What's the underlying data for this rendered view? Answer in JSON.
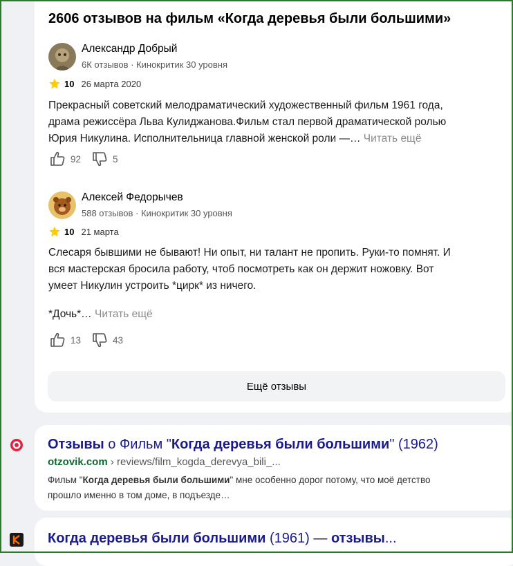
{
  "reviews_block": {
    "title": "2606 отзывов на фильм «Когда деревья были большими»",
    "reviews": [
      {
        "author": "Александр Добрый",
        "meta": "6К отзывов · Кинокритик 30 уровня",
        "score": "10",
        "date": "26 марта 2020",
        "text_lines": [
          "Прекрасный советский мелодраматический художественный фильм 1961 года,",
          "драма режиссёра Льва Кулиджанова.Фильм стал первой драматической ролью",
          "Юрия Никулина. Исполнительница главной женской роли —…"
        ],
        "read_more": "Читать ещё",
        "likes": "92",
        "dislikes": "5"
      },
      {
        "author": "Алексей Федорычев",
        "meta": "588 отзывов · Кинокритик 30 уровня",
        "score": "10",
        "date": "21 марта",
        "text_lines": [
          "Слесаря бывшими не бывают! Ни опыт, ни талант не пропить. Руки-то помнят. И",
          "вся мастерская бросила работу, чтоб посмотреть как он держит ножовку. Вот",
          "умеет Никулин устроить *цирк* из ничего."
        ],
        "tail": "*Дочь*…",
        "read_more": "Читать ещё",
        "likes": "13",
        "dislikes": "43"
      }
    ],
    "more_button": "Ещё отзывы"
  },
  "results": [
    {
      "favicon": "otzovik-icon",
      "title_bold": "Отзывы",
      "title_mid": " о Фильм \"",
      "title_bold2": "Когда деревья были большими",
      "title_end": "\" (1962)",
      "host": "otzovik.com",
      "path": " › reviews/film_kogda_derevya_bili_...",
      "snippet_pre": "Фильм \"",
      "snippet_bold": "Когда деревья были большими",
      "snippet_post": "\" мне особенно дорог потому, что моё детство",
      "snippet_line2": "прошло именно в том доме, в подъезде…"
    },
    {
      "favicon": "kinopoisk-icon",
      "title_bold": "Когда деревья были большими",
      "title_mid": " (1961) — ",
      "title_bold2": "отзывы",
      "title_end": "..."
    }
  ],
  "colors": {
    "link": "#1a1a8c",
    "url_host": "#0b6b2e",
    "star": "#ffcc00",
    "background": "#f0f1f4"
  }
}
